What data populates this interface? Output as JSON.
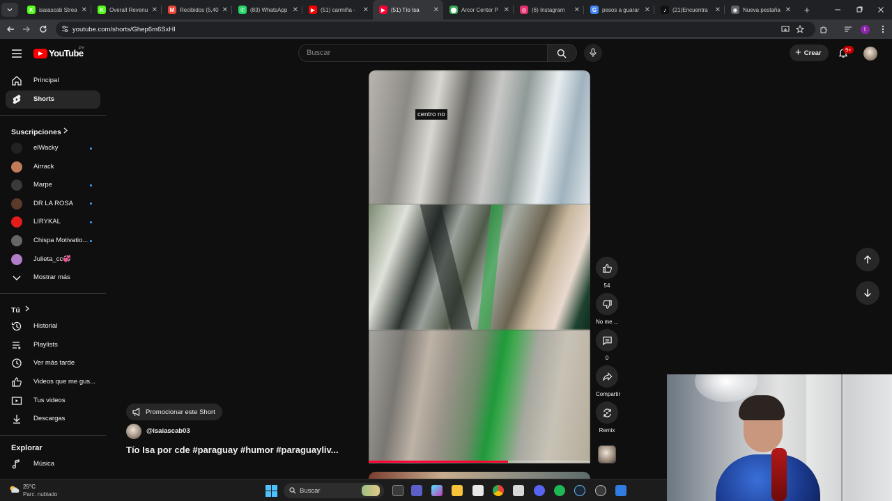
{
  "browser": {
    "tabs": [
      {
        "label": "isaiascab Strea",
        "fav": "K",
        "color": "#53fc18",
        "active": false
      },
      {
        "label": "Overall Revenu",
        "fav": "K",
        "color": "#53fc18",
        "active": false
      },
      {
        "label": "Recibidos (5,40",
        "fav": "M",
        "color": "#ea4335",
        "active": false
      },
      {
        "label": "(83) WhatsApp",
        "fav": "✆",
        "color": "#25d366",
        "active": false
      },
      {
        "label": "(51) carmiña -",
        "fav": "▶",
        "color": "#ff0000",
        "active": false
      },
      {
        "label": "(51) Tío Isa",
        "fav": "▶",
        "color": "#ff0033",
        "active": true
      },
      {
        "label": "Arcor Center P",
        "fav": "⬤",
        "color": "#34a853",
        "active": false
      },
      {
        "label": "(6) Instagram",
        "fav": "◎",
        "color": "#e1306c",
        "active": false
      },
      {
        "label": "pesos a guarar",
        "fav": "G",
        "color": "#4285f4",
        "active": false
      },
      {
        "label": "(21)Encuentra",
        "fav": "♪",
        "color": "#111111",
        "active": false
      },
      {
        "label": "Nueva pestaña",
        "fav": "◉",
        "color": "#5f6368",
        "active": false
      }
    ],
    "url": "youtube.com/shorts/Ghep6m6SxHI"
  },
  "header": {
    "logo_text": "YouTube",
    "country": "PY",
    "search_placeholder": "Buscar",
    "create_label": "Crear",
    "notif_badge": "9+"
  },
  "sidebar": {
    "main": [
      {
        "label": "Principal",
        "icon": "home-icon"
      },
      {
        "label": "Shorts",
        "icon": "shorts-icon"
      }
    ],
    "subs_heading": "Suscripciones",
    "subs": [
      {
        "label": "elWacky",
        "color": "#222222",
        "new": true
      },
      {
        "label": "Airrack",
        "color": "#c07b5a",
        "new": false
      },
      {
        "label": "Marpe",
        "color": "#3a3a3a",
        "new": true
      },
      {
        "label": "DR LA ROSA",
        "color": "#5b3a2a",
        "new": true
      },
      {
        "label": "LIRYKAL",
        "color": "#e31c1c",
        "new": true
      },
      {
        "label": "Chispa Motivatio...",
        "color": "#666666",
        "new": true
      },
      {
        "label": "Julieta_cc💞",
        "color": "#b07ec7",
        "new": false
      }
    ],
    "show_more": "Mostrar más",
    "you_heading": "Tú",
    "you": [
      {
        "label": "Historial",
        "icon": "history-icon"
      },
      {
        "label": "Playlists",
        "icon": "playlists-icon"
      },
      {
        "label": "Ver más tarde",
        "icon": "watch-later-icon"
      },
      {
        "label": "Videos que me gus...",
        "icon": "liked-videos-icon"
      },
      {
        "label": "Tus videos",
        "icon": "your-videos-icon"
      },
      {
        "label": "Descargas",
        "icon": "downloads-icon"
      }
    ],
    "explore_heading": "Explorar",
    "explore": [
      {
        "label": "Música",
        "icon": "music-icon"
      }
    ]
  },
  "short": {
    "caption": "centro no",
    "promote_label": "Promocionar este Short",
    "channel": "@isaiascab03",
    "title": "Tío Isa por cde #paraguay #humor #paraguayliv...",
    "progress": 0.63
  },
  "actions": {
    "likes": "54",
    "dislike_label": "No me ...",
    "comments": "0",
    "share_label": "Compartir",
    "remix_label": "Remix"
  },
  "taskbar": {
    "temperature": "25°C",
    "weather": "Parc. nublado",
    "search_placeholder": "Buscar"
  }
}
